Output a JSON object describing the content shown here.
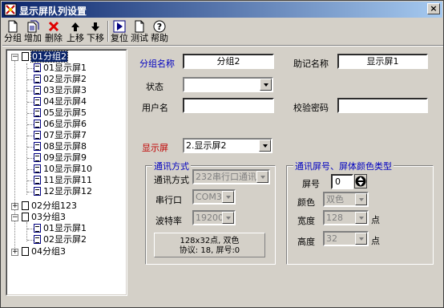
{
  "window": {
    "title": "显示屏队列设置",
    "close_label": "×"
  },
  "toolbar": {
    "buttons": [
      {
        "label": "分组",
        "icon": "new-document-icon"
      },
      {
        "label": "增加",
        "icon": "add-document-icon"
      },
      {
        "label": "删除",
        "icon": "delete-x-icon"
      },
      {
        "label": "上移",
        "icon": "arrow-up-icon"
      },
      {
        "label": "下移",
        "icon": "arrow-down-icon"
      },
      {
        "label": "复位",
        "icon": "play-reset-icon"
      },
      {
        "label": "测试",
        "icon": "test-document-icon"
      },
      {
        "label": "帮助",
        "icon": "help-icon"
      }
    ]
  },
  "tree": {
    "group1": {
      "label": "01分组2",
      "expander": "−",
      "items": [
        "01显示屏1",
        "02显示屏2",
        "03显示屏3",
        "04显示屏4",
        "05显示屏5",
        "06显示屏6",
        "07显示屏7",
        "08显示屏8",
        "09显示屏9",
        "10显示屏10",
        "11显示屏11",
        "12显示屏12"
      ]
    },
    "group2": {
      "label": "02分组123",
      "expander": "+"
    },
    "group3": {
      "label": "03分组3",
      "expander": "−",
      "items": [
        "01显示屏1",
        "02显示屏2"
      ]
    },
    "group4": {
      "label": "04分组3",
      "expander": "+"
    }
  },
  "form": {
    "group_name_label": "分组名称",
    "group_name_value": "分组2",
    "mnemonic_label": "助记名称",
    "mnemonic_value": "显示屏1",
    "status_label": "状态",
    "status_value": "",
    "username_label": "用户名",
    "username_value": "",
    "checkpwd_label": "校验密码",
    "checkpwd_value": "",
    "screen_label": "显示屏",
    "screen_value": "2.显示屏2"
  },
  "comm": {
    "title": "通讯方式",
    "mode_label": "通讯方式",
    "mode_value": "232串行口通讯",
    "port_label": "串行口",
    "port_value": "COM3",
    "baud_label": "波特率",
    "baud_value": "19200",
    "info_line1": "128x32点, 双色",
    "info_line2": "协议: 18, 屏号:0"
  },
  "screen": {
    "title": "通讯屏号、屏体颜色类型",
    "number_label": "屏号",
    "number_value": "0",
    "color_label": "颜色",
    "color_value": "双色",
    "width_label": "宽度",
    "width_value": "128",
    "width_unit": "点",
    "height_label": "高度",
    "height_value": "32",
    "height_unit": "点"
  },
  "colors": {
    "title_start": "#0a246a",
    "title_end": "#a6caf0",
    "accent_blue": "#0000c0",
    "accent_red": "#c00000",
    "face": "#d4d0c8"
  }
}
